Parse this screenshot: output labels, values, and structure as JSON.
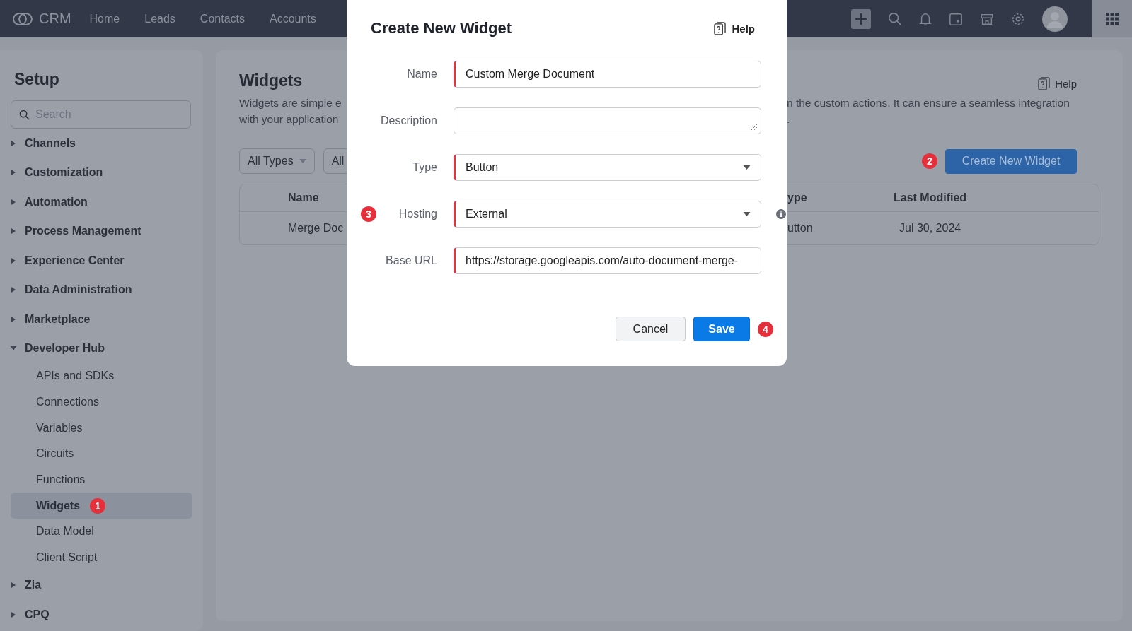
{
  "topbar": {
    "app_name": "CRM",
    "nav": [
      "Home",
      "Leads",
      "Contacts",
      "Accounts"
    ]
  },
  "sidebar": {
    "title": "Setup",
    "search": {
      "placeholder": "Search"
    },
    "items": [
      {
        "label": "Channels",
        "expanded": false,
        "selected": false
      },
      {
        "label": "Customization",
        "expanded": false,
        "selected": false
      },
      {
        "label": "Automation",
        "expanded": false,
        "selected": false
      },
      {
        "label": "Process Management",
        "expanded": false,
        "selected": false
      },
      {
        "label": "Experience Center",
        "expanded": false,
        "selected": false
      },
      {
        "label": "Data Administration",
        "expanded": false,
        "selected": false
      },
      {
        "label": "Marketplace",
        "expanded": false,
        "selected": false
      },
      {
        "label": "Developer Hub",
        "expanded": true,
        "selected": false,
        "children": [
          {
            "label": "APIs and SDKs",
            "selected": false
          },
          {
            "label": "Connections",
            "selected": false
          },
          {
            "label": "Variables",
            "selected": false
          },
          {
            "label": "Circuits",
            "selected": false
          },
          {
            "label": "Functions",
            "selected": false
          },
          {
            "label": "Widgets",
            "selected": true,
            "badge": "1"
          },
          {
            "label": "Data Model",
            "selected": false
          },
          {
            "label": "Client Script",
            "selected": false
          }
        ]
      },
      {
        "label": "Zia",
        "expanded": false,
        "selected": false
      },
      {
        "label": "CPQ",
        "expanded": false,
        "selected": false
      }
    ]
  },
  "content": {
    "title": "Widgets",
    "help": "Help",
    "description_left": [
      "Widgets are simple e",
      "with your application"
    ],
    "description_right": [
      "n the custom actions. It can ensure a seamless integration",
      "."
    ],
    "filters": [
      "All Types",
      "All"
    ],
    "create_button": {
      "label": "Create New Widget",
      "badge": "2"
    },
    "table": {
      "columns_left": [
        "Name"
      ],
      "columns_right": [
        "ype",
        "Last Modified"
      ],
      "rows": [
        {
          "left": [
            "Merge Doc"
          ],
          "right": [
            "utton",
            "Jul 30, 2024"
          ]
        }
      ]
    }
  },
  "dialog": {
    "title": "Create New Widget",
    "help": "Help",
    "fields": [
      {
        "label": "Name",
        "kind": "text",
        "required": true,
        "value": "Custom Merge Document"
      },
      {
        "label": "Description",
        "kind": "textarea",
        "required": false
      },
      {
        "label": "Type",
        "kind": "select",
        "required": true,
        "value": "Button"
      },
      {
        "label": "Hosting",
        "kind": "select",
        "required": true,
        "value": "External",
        "badge": "3",
        "info": true
      },
      {
        "label": "Base URL",
        "kind": "text",
        "required": true,
        "value": "https://storage.googleapis.com/auto-document-merge-"
      }
    ],
    "buttons": [
      {
        "label": "Cancel",
        "kind": "secondary"
      },
      {
        "label": "Save",
        "kind": "primary",
        "badge": "4"
      }
    ]
  }
}
